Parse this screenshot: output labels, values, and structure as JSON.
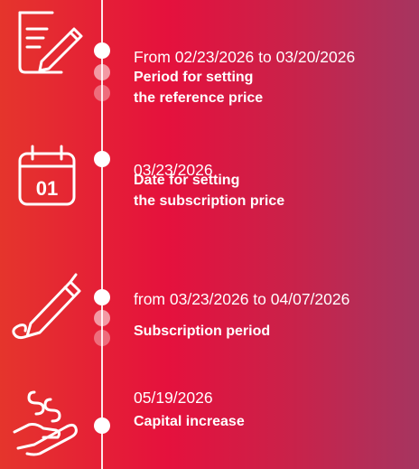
{
  "timeline": {
    "events": [
      {
        "date": "From 02/23/2026 to 03/20/2026",
        "title_line1": "Period for setting",
        "title_line2": "the reference price",
        "icon": "document-pen-icon"
      },
      {
        "date": "03/23/2026",
        "title_line1": "Date for setting",
        "title_line2": "the subscription price",
        "icon": "calendar-icon"
      },
      {
        "date": "from 03/23/2026 to 04/07/2026",
        "title_line1": "Subscription period",
        "icon": "pen-icon"
      },
      {
        "date": "05/19/2026",
        "title_line1": "Capital increase",
        "icon": "hand-coins-icon"
      }
    ]
  },
  "colors": {
    "gradient_left": "#e5352c",
    "gradient_mid": "#e5113d",
    "gradient_right": "#a63560",
    "foreground": "#ffffff"
  }
}
